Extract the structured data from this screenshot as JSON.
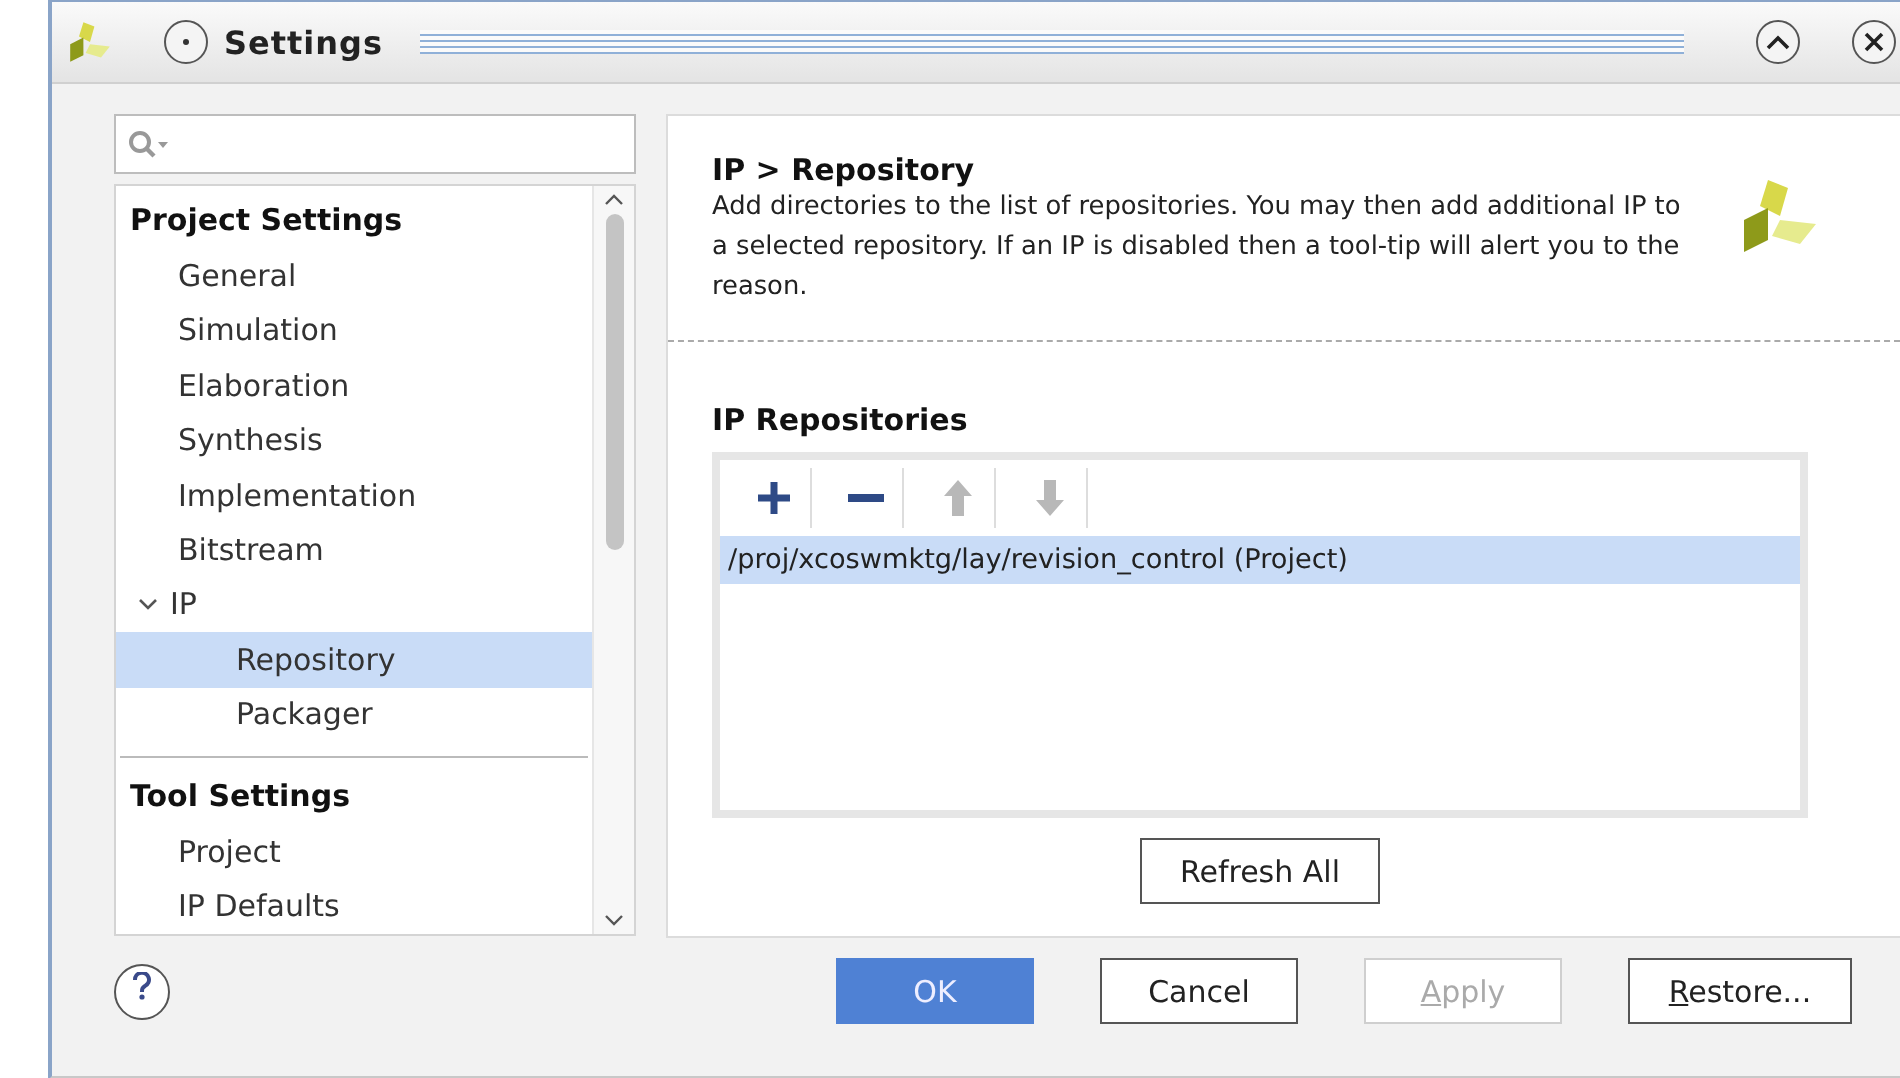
{
  "window": {
    "title": "Settings"
  },
  "tree": [
    {
      "title": "Project Settings",
      "items": [
        {
          "label": "General",
          "selected": false
        },
        {
          "label": "Simulation",
          "selected": false
        },
        {
          "label": "Elaboration",
          "selected": false
        },
        {
          "label": "Synthesis",
          "selected": false
        },
        {
          "label": "Implementation",
          "selected": false
        },
        {
          "label": "Bitstream",
          "selected": false
        },
        {
          "label": "IP",
          "selected": false,
          "expanded": true,
          "children": [
            {
              "label": "Repository",
              "selected": true
            },
            {
              "label": "Packager",
              "selected": false
            }
          ]
        }
      ]
    },
    {
      "title": "Tool Settings",
      "items": [
        {
          "label": "Project",
          "selected": false
        },
        {
          "label": "IP Defaults",
          "selected": false
        }
      ]
    }
  ],
  "panel": {
    "breadcrumb": "IP > Repository",
    "description": "Add directories to the list of repositories. You may then add additional IP to a selected repository. If an IP is disabled then a tool-tip will alert you to the reason.",
    "section_title": "IP Repositories",
    "toolbar": [
      {
        "kind": "add",
        "disabled": false
      },
      {
        "kind": "remove",
        "disabled": false
      },
      {
        "kind": "up",
        "disabled": true
      },
      {
        "kind": "down",
        "disabled": true
      }
    ],
    "repositories": [
      {
        "path": "/proj/xcoswmktg/lay/revision_control (Project)",
        "selected": true
      }
    ],
    "refresh_button": "Refresh All"
  },
  "buttons": [
    {
      "label": "OK",
      "kind": "primary",
      "disabled": false,
      "underline_first": false
    },
    {
      "label": "Cancel",
      "kind": "normal",
      "disabled": false,
      "underline_first": false
    },
    {
      "label": "Apply",
      "kind": "normal",
      "disabled": true,
      "underline_first": true
    },
    {
      "label": "Restore...",
      "kind": "normal",
      "disabled": false,
      "underline_first": true
    }
  ]
}
